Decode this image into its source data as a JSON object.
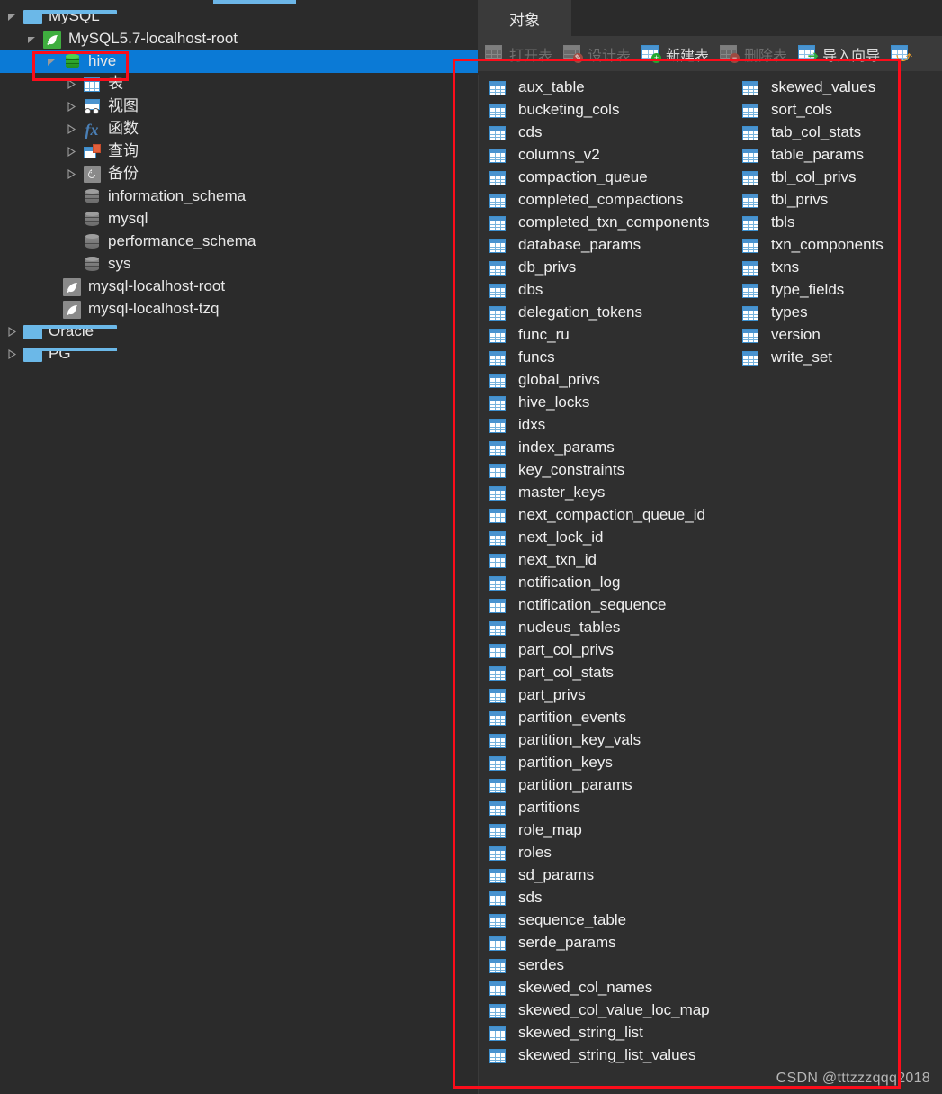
{
  "window": {
    "theme_background": "#2b2b2b",
    "accent_color": "#0b7ad6",
    "annotation_color": "#fc0d1b",
    "watermark": "CSDN @tttzzzqqq2018"
  },
  "sidebar": {
    "nodes": [
      {
        "label": "MySQL",
        "icon": "folder-icon",
        "indent": 0,
        "twisty": "expanded",
        "selected": false
      },
      {
        "label": "MySQL5.7-localhost-root",
        "icon": "dolphin-green-icon",
        "indent": 1,
        "twisty": "expanded",
        "selected": false
      },
      {
        "label": "hive",
        "icon": "database-green-icon",
        "indent": 2,
        "twisty": "expanded",
        "selected": true
      },
      {
        "label": "表",
        "icon": "table-grid-icon",
        "indent": 3,
        "twisty": "collapsed",
        "selected": false
      },
      {
        "label": "视图",
        "icon": "view-icon",
        "indent": 3,
        "twisty": "collapsed",
        "selected": false
      },
      {
        "label": "函数",
        "icon": "fx-icon",
        "indent": 3,
        "twisty": "collapsed",
        "selected": false
      },
      {
        "label": "查询",
        "icon": "query-icon",
        "indent": 3,
        "twisty": "collapsed",
        "selected": false
      },
      {
        "label": "备份",
        "icon": "backup-icon",
        "indent": 3,
        "twisty": "collapsed",
        "selected": false
      },
      {
        "label": "information_schema",
        "icon": "database-grey-icon",
        "indent": 3,
        "twisty": "none",
        "selected": false
      },
      {
        "label": "mysql",
        "icon": "database-grey-icon",
        "indent": 3,
        "twisty": "none",
        "selected": false
      },
      {
        "label": "performance_schema",
        "icon": "database-grey-icon",
        "indent": 3,
        "twisty": "none",
        "selected": false
      },
      {
        "label": "sys",
        "icon": "database-grey-icon",
        "indent": 3,
        "twisty": "none",
        "selected": false
      },
      {
        "label": "mysql-localhost-root",
        "icon": "dolphin-grey-icon",
        "indent": 2,
        "twisty": "none",
        "selected": false
      },
      {
        "label": "mysql-localhost-tzq",
        "icon": "dolphin-grey-icon",
        "indent": 2,
        "twisty": "none",
        "selected": false
      },
      {
        "label": "Oracle",
        "icon": "folder-icon",
        "indent": 0,
        "twisty": "collapsed",
        "selected": false
      },
      {
        "label": "PG",
        "icon": "folder-icon",
        "indent": 0,
        "twisty": "collapsed",
        "selected": false
      }
    ]
  },
  "main": {
    "tabs": [
      {
        "label": "对象",
        "active": true
      }
    ],
    "toolbar": [
      {
        "label": "打开表",
        "icon": "open-table-icon",
        "enabled": false,
        "badge": "none"
      },
      {
        "label": "设计表",
        "icon": "design-table-icon",
        "enabled": false,
        "badge": "pencil"
      },
      {
        "label": "新建表",
        "icon": "new-table-icon",
        "enabled": true,
        "badge": "plus"
      },
      {
        "label": "删除表",
        "icon": "delete-table-icon",
        "enabled": false,
        "badge": "minus"
      },
      {
        "label": "导入向导",
        "icon": "import-wizard-icon",
        "enabled": true,
        "badge": "arrow-green"
      },
      {
        "label": "",
        "icon": "export-wizard-icon",
        "enabled": true,
        "badge": "arrow-orange"
      }
    ],
    "table_columns": [
      [
        "aux_table",
        "bucketing_cols",
        "cds",
        "columns_v2",
        "compaction_queue",
        "completed_compactions",
        "completed_txn_components",
        "database_params",
        "db_privs",
        "dbs",
        "delegation_tokens",
        "func_ru",
        "funcs",
        "global_privs",
        "hive_locks",
        "idxs",
        "index_params",
        "key_constraints",
        "master_keys",
        "next_compaction_queue_id",
        "next_lock_id",
        "next_txn_id",
        "notification_log",
        "notification_sequence",
        "nucleus_tables",
        "part_col_privs",
        "part_col_stats",
        "part_privs",
        "partition_events",
        "partition_key_vals",
        "partition_keys",
        "partition_params",
        "partitions",
        "role_map",
        "roles",
        "sd_params",
        "sds",
        "sequence_table",
        "serde_params",
        "serdes",
        "skewed_col_names",
        "skewed_col_value_loc_map",
        "skewed_string_list",
        "skewed_string_list_values"
      ],
      [
        "skewed_values",
        "sort_cols",
        "tab_col_stats",
        "table_params",
        "tbl_col_privs",
        "tbl_privs",
        "tbls",
        "txn_components",
        "txns",
        "type_fields",
        "types",
        "version",
        "write_set"
      ]
    ]
  }
}
